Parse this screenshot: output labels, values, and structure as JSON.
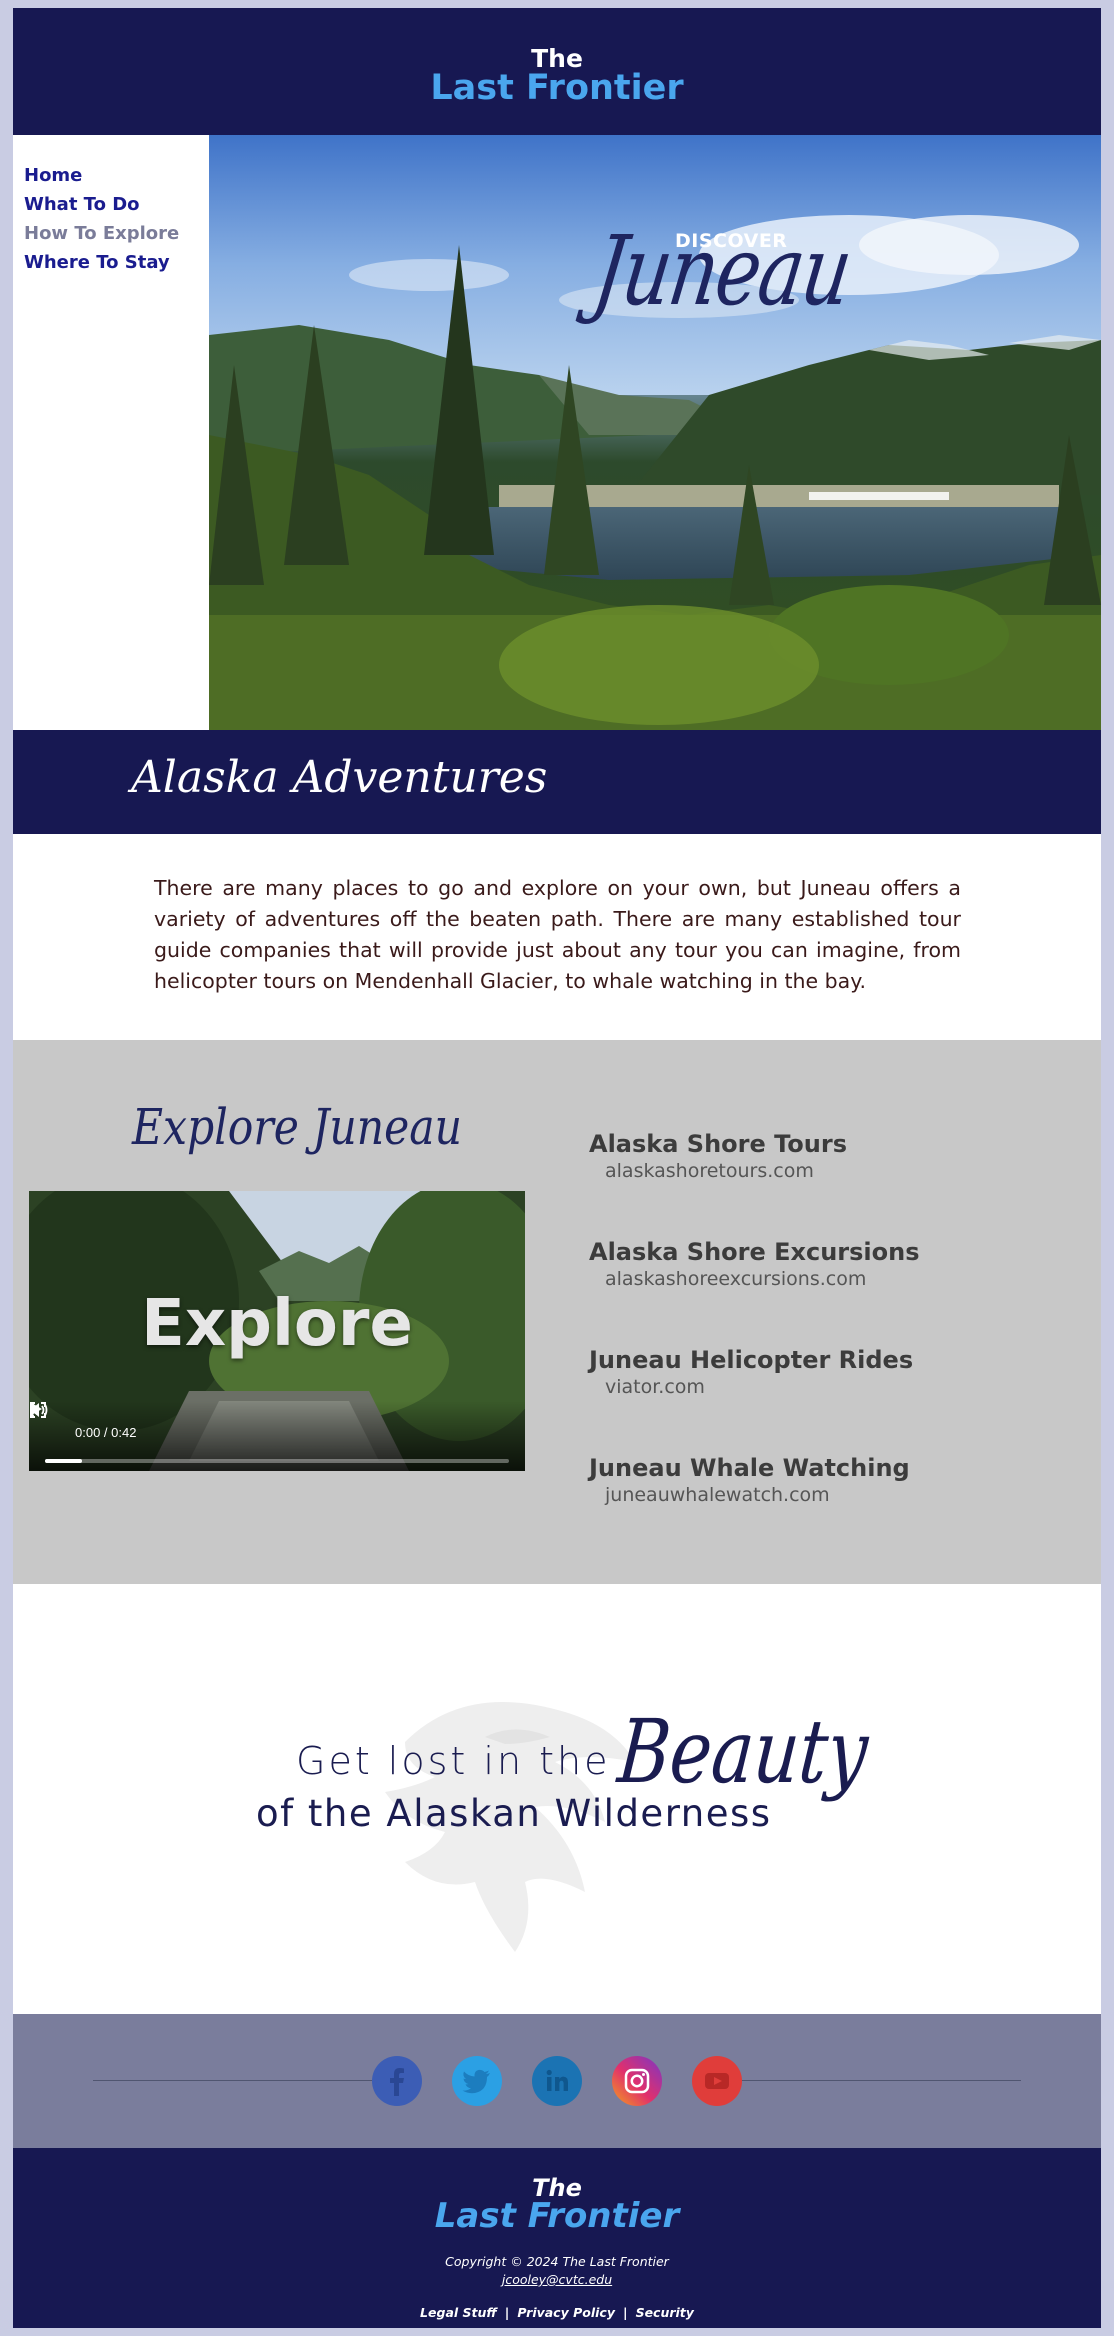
{
  "header": {
    "title_top": "The",
    "title_main": "Last Frontier"
  },
  "nav": {
    "items": [
      {
        "label": "Home"
      },
      {
        "label": "What To Do"
      },
      {
        "label": "How To Explore"
      },
      {
        "label": "Where To Stay"
      }
    ]
  },
  "hero": {
    "kicker": "DISCOVER",
    "title": "Juneau"
  },
  "adventures": {
    "title": "Alaska Adventures",
    "body": "There are many places to go and explore on your own, but Juneau offers a variety of adventures off the beaten path. There are many established tour guide companies that will provide just about any tour you can imagine, from helicopter tours on Mendenhall Glacier, to whale watching in the bay."
  },
  "explore": {
    "title": "Explore Juneau",
    "video": {
      "overlay_text": "Explore",
      "time": "0:00 / 0:42",
      "progress": 0.08
    },
    "tours": [
      {
        "name": "Alaska Shore Tours",
        "url": "alaskashoretours.com"
      },
      {
        "name": "Alaska Shore Excursions",
        "url": "alaskashoreexcursions.com"
      },
      {
        "name": "Juneau Helicopter Rides",
        "url": "viator.com"
      },
      {
        "name": "Juneau Whale Watching",
        "url": "juneauwhalewatch.com"
      }
    ]
  },
  "tagline": {
    "line1": "Get lost in the",
    "emphasis": "Beauty",
    "line2": "of the Alaskan Wilderness"
  },
  "social": {
    "icons": [
      "facebook-icon",
      "twitter-icon",
      "linkedin-icon",
      "instagram-icon",
      "youtube-icon"
    ]
  },
  "footer": {
    "title_top": "The",
    "title_main": "Last Frontier",
    "copyright": "Copyright © 2024 The Last Frontier",
    "email": "jcooley@cvtc.edu",
    "links": [
      "Legal Stuff",
      "Privacy Policy",
      "Security"
    ],
    "separator": "|"
  },
  "colors": {
    "navy": "#171852",
    "accent_blue": "#4aa6ee",
    "nav_link": "#1a1c8f",
    "nav_muted": "#7a7c99",
    "gray_section": "#c8c8c8",
    "social_band": "#7a7d9c"
  }
}
